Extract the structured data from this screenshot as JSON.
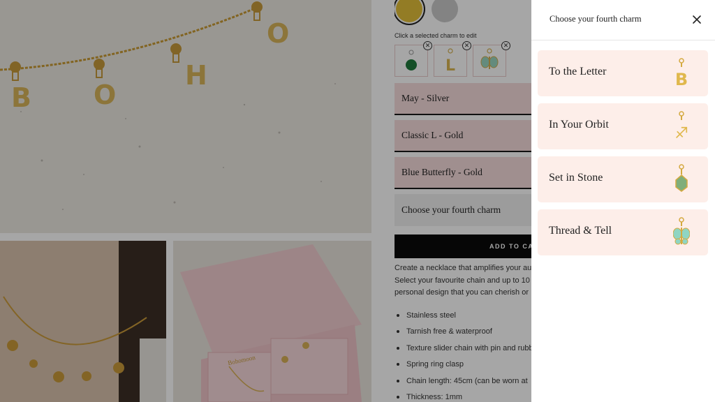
{
  "product": {
    "metal_swatches": [
      {
        "name": "gold-swatch",
        "color": "#e2bf3a",
        "selected": true
      },
      {
        "name": "silver-swatch",
        "color": "#c9c9c9",
        "selected": false
      }
    ],
    "edit_hint": "Click a selected charm to edit",
    "selected_charms": [
      {
        "icon": "green-birthstone-charm-icon"
      },
      {
        "icon": "letter-l-charm-icon",
        "letter": "L"
      },
      {
        "icon": "butterfly-charm-icon"
      }
    ],
    "charm_rows": [
      {
        "label": "May - Silver"
      },
      {
        "label": "Classic L - Gold"
      },
      {
        "label": "Blue Butterfly - Gold"
      },
      {
        "label": "Choose your fourth charm"
      }
    ],
    "add_to_cart_label": "ADD TO CA",
    "description_lines": [
      "Create a necklace that amplifies your au",
      "Select your favourite chain and up to 10 c",
      "personal design that you can cherish or"
    ],
    "features": [
      "Stainless steel",
      "Tarnish free & waterproof",
      "Texture slider chain with pin and rubb",
      "Spring ring clasp",
      "Chain length: 45cm (can be worn at",
      "Thickness: 1mm"
    ]
  },
  "gallery": {
    "necklace_letters": [
      "B",
      "O",
      "H",
      "O"
    ],
    "box_text": "Bohomoon"
  },
  "drawer": {
    "title": "Choose your fourth charm",
    "close_icon": "close-icon",
    "options": [
      {
        "label": "To the Letter",
        "icon": "letter-b-charm-icon",
        "letter": "B"
      },
      {
        "label": "In Your Orbit",
        "icon": "zodiac-charm-icon",
        "letter": "♐"
      },
      {
        "label": "Set in Stone",
        "icon": "birthstone-charm-icon"
      },
      {
        "label": "Thread & Tell",
        "icon": "butterfly-charm-icon"
      }
    ]
  },
  "colors": {
    "accent_gold": "#d9b23c",
    "option_bg": "#fdeee9",
    "row_pink": "#f6dcdc"
  }
}
